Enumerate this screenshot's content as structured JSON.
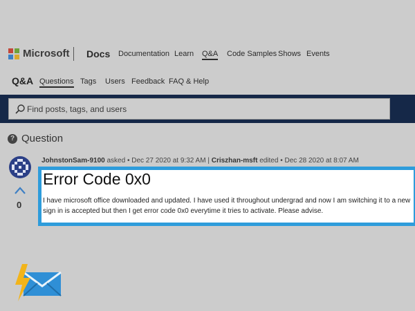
{
  "header": {
    "brand": "Microsoft",
    "product": "Docs",
    "nav": [
      "Documentation",
      "Learn",
      "Q&A",
      "Code Samples",
      "Shows",
      "Events"
    ],
    "active_nav": "Q&A"
  },
  "subnav": {
    "title": "Q&A",
    "items": [
      "Questions",
      "Tags",
      "Users",
      "Feedback",
      "FAQ & Help"
    ],
    "active": "Questions"
  },
  "search": {
    "placeholder": "Find posts, tags, and users"
  },
  "section": {
    "title": "Question"
  },
  "post": {
    "author": "JohnstonSam-9100",
    "asked_text": "asked",
    "asked_date": "Dec 27 2020 at 9:32 AM",
    "editor": "Criszhan-msft",
    "edited_text": "edited",
    "edited_date": "Dec 28 2020 at 8:07 AM",
    "votes": "0",
    "title": "Error Code 0x0",
    "body_line1": "I have microsoft office downloaded and updated. I have used it throughout undergrad and now I am switching it to a new",
    "body_line2": "sign in is accepted but then I get error code 0x0 everytime it tries to activate. Please advise."
  },
  "colors": {
    "background": "#cccccc",
    "search_band": "#152848",
    "highlight_border": "#2e9cdb",
    "ms_red": "#c2473a",
    "ms_green": "#6fa13c",
    "ms_blue": "#3d7fc4",
    "ms_yellow": "#d9a92e"
  }
}
